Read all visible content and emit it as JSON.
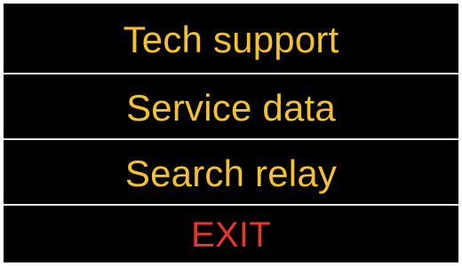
{
  "menu": {
    "items": [
      {
        "label": "Tech support"
      },
      {
        "label": "Service data"
      },
      {
        "label": "Search relay"
      },
      {
        "label": "EXIT"
      }
    ]
  },
  "colors": {
    "background": "#000000",
    "item_text": "#f2c230",
    "exit_text": "#e8362f",
    "divider": "#e8e8e8"
  }
}
